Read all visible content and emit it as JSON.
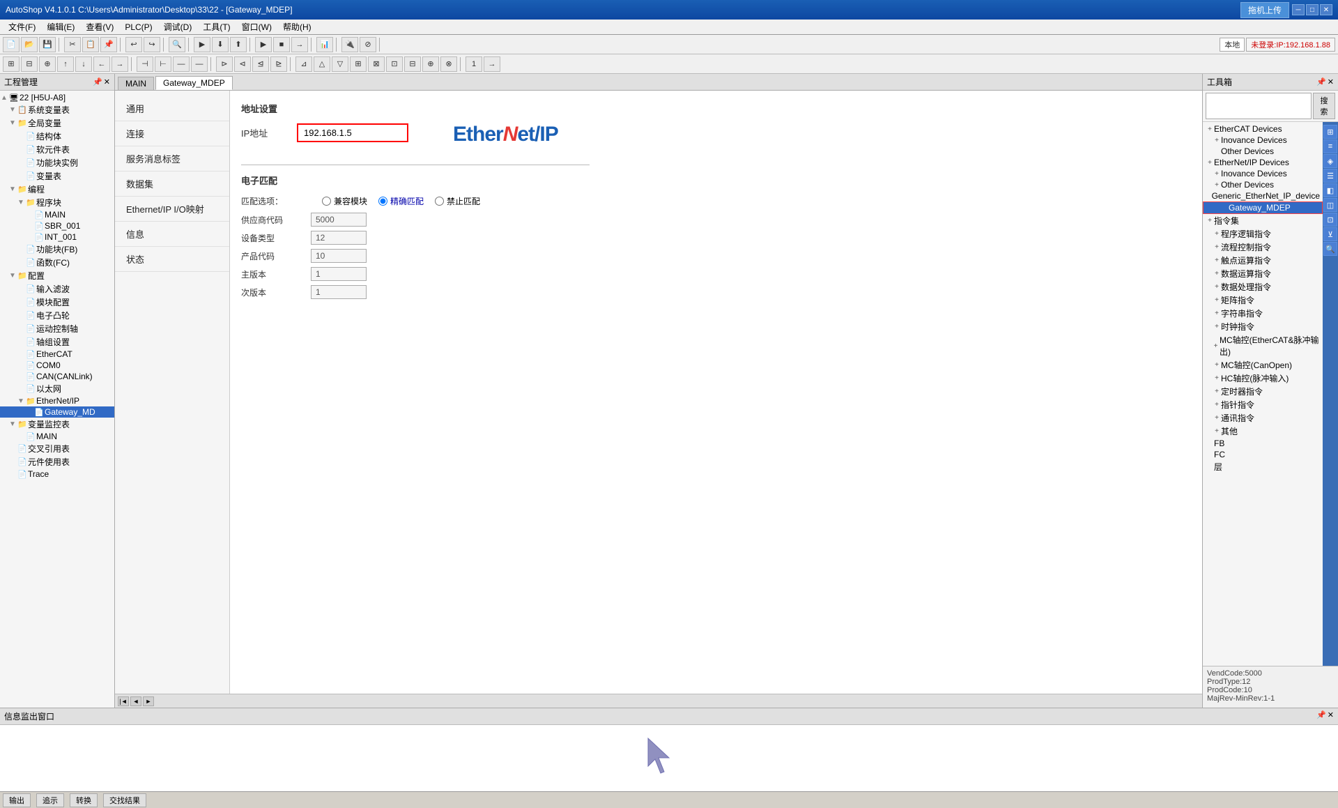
{
  "titlebar": {
    "title": "AutoShop V4.1.0.1  C:\\Users\\Administrator\\Desktop\\33\\22 - [Gateway_MDEP]",
    "upload_btn": "拖机上传",
    "win_minimize": "─",
    "win_maximize": "□",
    "win_close": "✕",
    "inner_minimize": "─",
    "inner_restore": "□",
    "inner_close": "✕"
  },
  "menubar": {
    "items": [
      "文件(F)",
      "编辑(E)",
      "查看(V)",
      "PLC(P)",
      "调试(D)",
      "工具(T)",
      "窗口(W)",
      "帮助(H)"
    ]
  },
  "toolbar": {
    "local_label": "本地",
    "login_label": "未登录:IP:192.168.1.88"
  },
  "left_panel": {
    "title": "工程管理",
    "tree": [
      {
        "indent": 0,
        "expand": "▲",
        "icon": "🖥",
        "text": "22 [H5U-A8]",
        "level": 0
      },
      {
        "indent": 1,
        "expand": "▼",
        "icon": "📋",
        "text": "系统变量表",
        "level": 1
      },
      {
        "indent": 1,
        "expand": "▼",
        "icon": "📁",
        "text": "全局变量",
        "level": 1
      },
      {
        "indent": 2,
        "expand": "",
        "icon": "📄",
        "text": "结构体",
        "level": 2
      },
      {
        "indent": 2,
        "expand": "",
        "icon": "📄",
        "text": "软元件表",
        "level": 2
      },
      {
        "indent": 2,
        "expand": "",
        "icon": "📄",
        "text": "功能块实例",
        "level": 2
      },
      {
        "indent": 2,
        "expand": "",
        "icon": "📄",
        "text": "变量表",
        "level": 2
      },
      {
        "indent": 1,
        "expand": "▼",
        "icon": "📁",
        "text": "编程",
        "level": 1
      },
      {
        "indent": 2,
        "expand": "▼",
        "icon": "📁",
        "text": "程序块",
        "level": 2
      },
      {
        "indent": 3,
        "expand": "",
        "icon": "📄",
        "text": "MAIN",
        "level": 3
      },
      {
        "indent": 3,
        "expand": "",
        "icon": "📄",
        "text": "SBR_001",
        "level": 3
      },
      {
        "indent": 3,
        "expand": "",
        "icon": "📄",
        "text": "INT_001",
        "level": 3
      },
      {
        "indent": 2,
        "expand": "",
        "icon": "📄",
        "text": "功能块(FB)",
        "level": 2
      },
      {
        "indent": 2,
        "expand": "",
        "icon": "📄",
        "text": "函数(FC)",
        "level": 2
      },
      {
        "indent": 1,
        "expand": "▼",
        "icon": "📁",
        "text": "配置",
        "level": 1
      },
      {
        "indent": 2,
        "expand": "",
        "icon": "📄",
        "text": "输入滤波",
        "level": 2
      },
      {
        "indent": 2,
        "expand": "",
        "icon": "📄",
        "text": "模块配置",
        "level": 2
      },
      {
        "indent": 2,
        "expand": "",
        "icon": "📄",
        "text": "电子凸轮",
        "level": 2
      },
      {
        "indent": 2,
        "expand": "",
        "icon": "📄",
        "text": "运动控制轴",
        "level": 2
      },
      {
        "indent": 2,
        "expand": "",
        "icon": "📄",
        "text": "轴组设置",
        "level": 2
      },
      {
        "indent": 2,
        "expand": "",
        "icon": "📄",
        "text": "EtherCAT",
        "level": 2
      },
      {
        "indent": 2,
        "expand": "",
        "icon": "📄",
        "text": "COM0",
        "level": 2
      },
      {
        "indent": 2,
        "expand": "",
        "icon": "📄",
        "text": "CAN(CANLink)",
        "level": 2
      },
      {
        "indent": 2,
        "expand": "",
        "icon": "📄",
        "text": "以太网",
        "level": 2
      },
      {
        "indent": 2,
        "expand": "▼",
        "icon": "📁",
        "text": "EtherNet/IP",
        "level": 2
      },
      {
        "indent": 3,
        "expand": "",
        "icon": "📄",
        "text": "Gateway_MD",
        "level": 3,
        "selected": true
      },
      {
        "indent": 1,
        "expand": "▼",
        "icon": "📁",
        "text": "变量监控表",
        "level": 1
      },
      {
        "indent": 2,
        "expand": "",
        "icon": "📄",
        "text": "MAIN",
        "level": 2
      },
      {
        "indent": 1,
        "expand": "",
        "icon": "📄",
        "text": "交叉引用表",
        "level": 1
      },
      {
        "indent": 1,
        "expand": "",
        "icon": "📄",
        "text": "元件使用表",
        "level": 1
      },
      {
        "indent": 1,
        "expand": "",
        "icon": "📄",
        "text": "Trace",
        "level": 1
      }
    ]
  },
  "center_tabs": [
    {
      "label": "MAIN",
      "active": false
    },
    {
      "label": "Gateway_MDEP",
      "active": true
    }
  ],
  "left_nav": {
    "items": [
      {
        "label": "通用",
        "active": false
      },
      {
        "label": "连接",
        "active": false
      },
      {
        "label": "服务消息标签",
        "active": false
      },
      {
        "label": "数据集",
        "active": false
      },
      {
        "label": "Ethernet/IP I/O映射",
        "active": false
      },
      {
        "label": "信息",
        "active": false
      },
      {
        "label": "状态",
        "active": false
      }
    ]
  },
  "config": {
    "address_section_title": "地址设置",
    "address_label": "IP地址",
    "address_value": "192.168.1.5",
    "ethernet_logo_main": "Ether",
    "ethernet_logo_accent": "N",
    "ethernet_logo_end": "et/IP",
    "edist_section_title": "电子匹配",
    "match_label": "匹配选项：",
    "radio_options": [
      "兼容模块",
      "精确匹配",
      "禁止匹配"
    ],
    "radio_selected": "精确匹配",
    "form_fields": [
      {
        "label": "供应商代码",
        "value": "5000"
      },
      {
        "label": "设备类型",
        "value": "12"
      },
      {
        "label": "产品代码",
        "value": "10"
      },
      {
        "label": "主版本",
        "value": "1"
      },
      {
        "label": "次版本",
        "value": "1"
      }
    ]
  },
  "right_panel": {
    "title": "工具箱",
    "search_placeholder": "",
    "search_btn": "搜索",
    "tree": [
      {
        "indent": 0,
        "expand": "+",
        "text": "EtherCAT Devices",
        "level": 0
      },
      {
        "indent": 1,
        "expand": "+",
        "text": "Inovance Devices",
        "level": 1
      },
      {
        "indent": 1,
        "expand": "",
        "text": "Other Devices",
        "level": 1
      },
      {
        "indent": 0,
        "expand": "+",
        "text": "EtherNet/IP Devices",
        "level": 0
      },
      {
        "indent": 1,
        "expand": "+",
        "text": "Inovance Devices",
        "level": 1
      },
      {
        "indent": 1,
        "expand": "+",
        "text": "Other Devices",
        "level": 1
      },
      {
        "indent": 2,
        "expand": "",
        "text": "Generic_EtherNet_IP_device",
        "level": 2
      },
      {
        "indent": 2,
        "expand": "",
        "text": "Gateway_MDEP",
        "level": 2,
        "highlighted": true
      },
      {
        "indent": 0,
        "expand": "+",
        "text": "指令集",
        "level": 0
      },
      {
        "indent": 1,
        "expand": "+",
        "text": "程序逻辑指令",
        "level": 1
      },
      {
        "indent": 1,
        "expand": "+",
        "text": "流程控制指令",
        "level": 1
      },
      {
        "indent": 1,
        "expand": "+",
        "text": "触点运算指令",
        "level": 1
      },
      {
        "indent": 1,
        "expand": "+",
        "text": "数据运算指令",
        "level": 1
      },
      {
        "indent": 1,
        "expand": "+",
        "text": "数据处理指令",
        "level": 1
      },
      {
        "indent": 1,
        "expand": "+",
        "text": "矩阵指令",
        "level": 1
      },
      {
        "indent": 1,
        "expand": "+",
        "text": "字符串指令",
        "level": 1
      },
      {
        "indent": 1,
        "expand": "+",
        "text": "时钟指令",
        "level": 1
      },
      {
        "indent": 1,
        "expand": "+",
        "text": "MC轴控(EtherCAT&脉冲输出)",
        "level": 1
      },
      {
        "indent": 1,
        "expand": "+",
        "text": "MC轴控(CanOpen)",
        "level": 1
      },
      {
        "indent": 1,
        "expand": "+",
        "text": "HC轴控(脉冲输入)",
        "level": 1
      },
      {
        "indent": 1,
        "expand": "+",
        "text": "定时器指令",
        "level": 1
      },
      {
        "indent": 1,
        "expand": "+",
        "text": "指针指令",
        "level": 1
      },
      {
        "indent": 1,
        "expand": "+",
        "text": "通讯指令",
        "level": 1
      },
      {
        "indent": 1,
        "expand": "+",
        "text": "其他",
        "level": 1
      },
      {
        "indent": 0,
        "expand": "",
        "text": "FB",
        "level": 0
      },
      {
        "indent": 0,
        "expand": "",
        "text": "FC",
        "level": 0
      },
      {
        "indent": 0,
        "expand": "",
        "text": "层",
        "level": 0
      }
    ],
    "info": {
      "vend_code": "VendCode:5000",
      "prod_type": "ProdType:12",
      "prod_code": "ProdCode:10",
      "maj_min_rev": "MajRev-MinRev:1-1"
    }
  },
  "bottom": {
    "title": "信息监出窗口",
    "tabs": [
      "输出",
      "追示",
      "转换",
      "交找结果"
    ]
  },
  "status_bar": {
    "items": [
      "输出",
      "追示",
      "转换",
      "交找结果"
    ]
  }
}
